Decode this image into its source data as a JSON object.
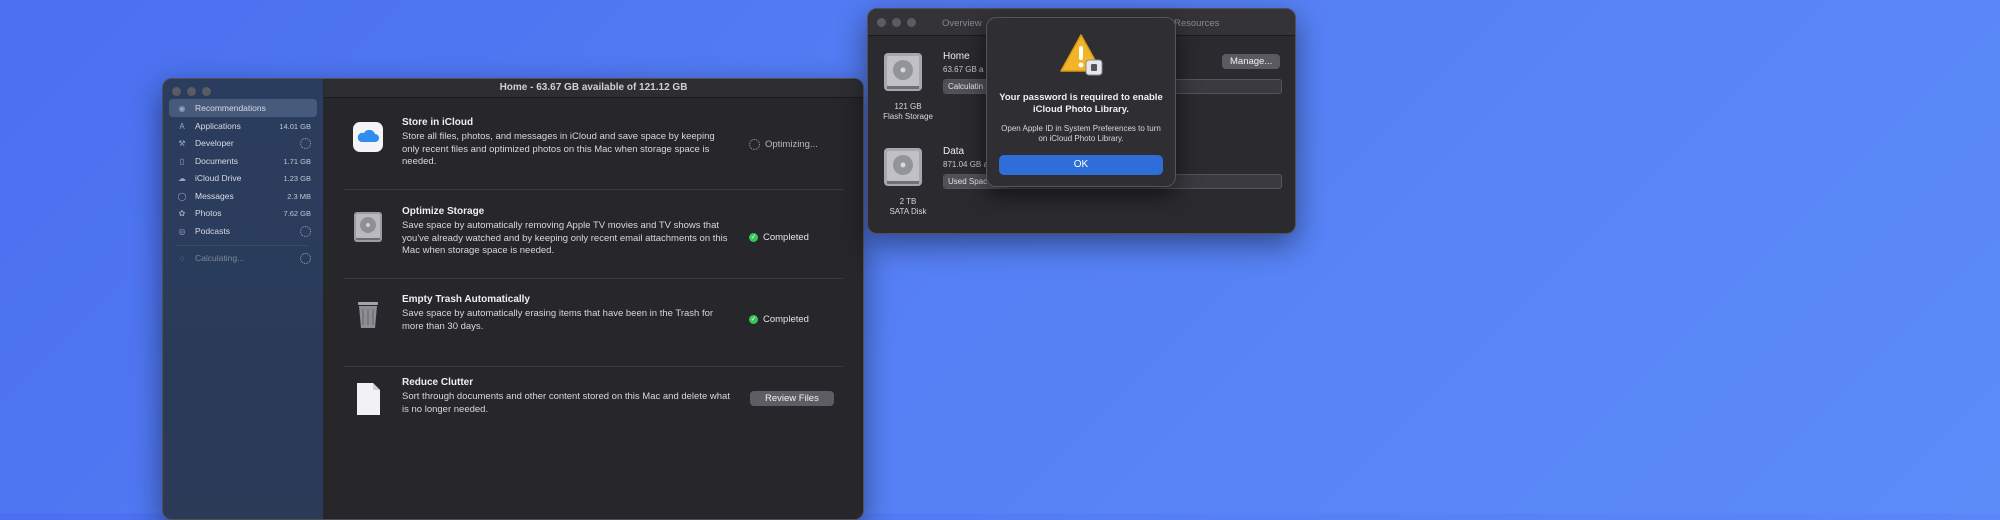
{
  "storage_window": {
    "title": "Home - 63.67 GB available of 121.12 GB",
    "sidebar": {
      "items": [
        {
          "label": "Recommendations",
          "size": "",
          "icon": "recommendations-icon"
        },
        {
          "label": "Applications",
          "size": "14.01 GB",
          "icon": "applications-icon"
        },
        {
          "label": "Developer",
          "size": "",
          "icon": "developer-icon"
        },
        {
          "label": "Documents",
          "size": "1.71 GB",
          "icon": "documents-icon"
        },
        {
          "label": "iCloud Drive",
          "size": "1.23 GB",
          "icon": "cloud-icon"
        },
        {
          "label": "Messages",
          "size": "2.3 MB",
          "icon": "messages-icon"
        },
        {
          "label": "Photos",
          "size": "7.62 GB",
          "icon": "photos-icon"
        },
        {
          "label": "Podcasts",
          "size": "",
          "icon": "podcasts-icon"
        },
        {
          "label": "Calculating...",
          "size": "",
          "icon": "calculating-icon"
        }
      ]
    },
    "recommendations": [
      {
        "title": "Store in iCloud",
        "desc": "Store all files, photos, and messages in iCloud and save space by keeping only recent files and optimized photos on this Mac when storage space is needed.",
        "status": "Optimizing...",
        "icon": "icloud-icon"
      },
      {
        "title": "Optimize Storage",
        "desc": "Save space by automatically removing Apple TV movies and TV shows that you've already watched and by keeping only recent email attachments on this Mac when storage space is needed.",
        "status": "Completed",
        "icon": "hard-drive-icon"
      },
      {
        "title": "Empty Trash Automatically",
        "desc": "Save space by automatically erasing items that have been in the Trash for more than 30 days.",
        "status": "Completed",
        "icon": "trash-icon"
      },
      {
        "title": "Reduce Clutter",
        "desc": "Sort through documents and other content stored on this Mac and delete what is no longer needed.",
        "button": "Review Files",
        "icon": "document-icon"
      }
    ]
  },
  "disk_window": {
    "tabs": {
      "overview": "Overview",
      "resources": "Resources"
    },
    "drives": [
      {
        "size": "121 GB",
        "type": "Flash Storage",
        "name": "Home",
        "available": "63.67 GB a",
        "bar_label": "Calculatin"
      },
      {
        "size": "2 TB",
        "type": "SATA Disk",
        "name": "Data",
        "available": "871.04 GB a",
        "bar_label": "Used Spac"
      }
    ],
    "manage_button": "Manage..."
  },
  "alert": {
    "title": "Your password is required to enable iCloud Photo Library.",
    "message": "Open Apple ID in System Preferences to turn on iCloud Photo Library.",
    "ok_button": "OK"
  },
  "colors": {
    "desktop": "#4f7bf4",
    "accent": "#2f6ed9",
    "success": "#35c759"
  }
}
